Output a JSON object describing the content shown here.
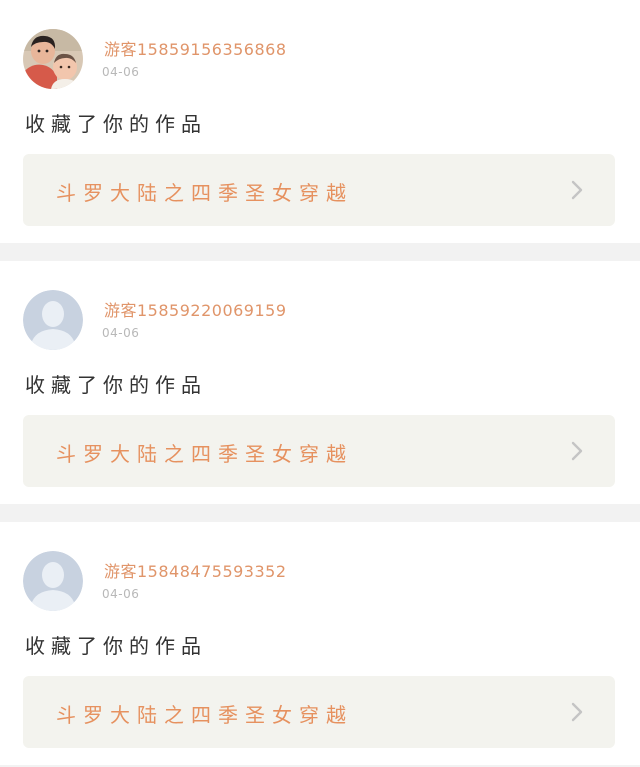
{
  "feed": {
    "items": [
      {
        "username": "游客15859156356868",
        "time": "04-06",
        "action": "收藏了你的作品",
        "work_title": "斗罗大陆之四季圣女穿越",
        "avatar": "photo-avatar"
      },
      {
        "username": "游客15859220069159",
        "time": "04-06",
        "action": "收藏了你的作品",
        "work_title": "斗罗大陆之四季圣女穿越",
        "avatar": "default-avatar"
      },
      {
        "username": "游客15848475593352",
        "time": "04-06",
        "action": "收藏了你的作品",
        "work_title": "斗罗大陆之四季圣女穿越",
        "avatar": "default-avatar"
      }
    ]
  },
  "colors": {
    "username": "#e0956a",
    "work_title": "#e6915f",
    "work_link_bg": "#f3f3ee",
    "time": "#b8b8b8",
    "divider": "#f2f2f2"
  },
  "icons": {
    "chevron": "chevron-right-icon"
  }
}
